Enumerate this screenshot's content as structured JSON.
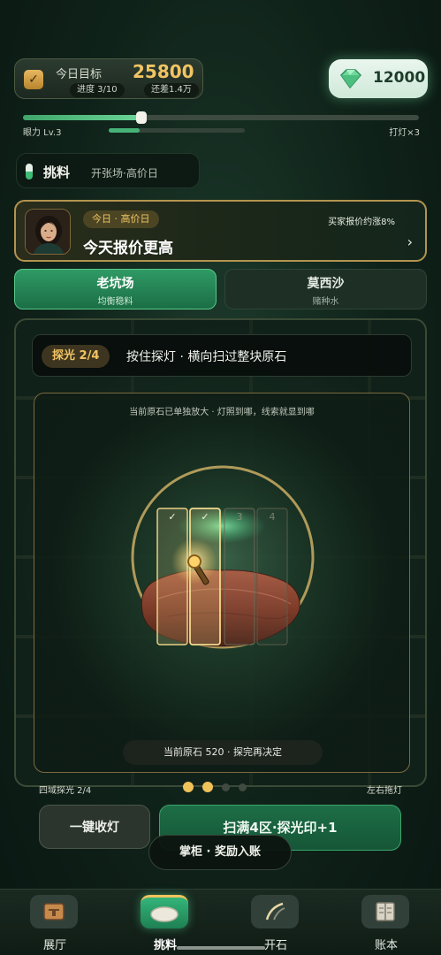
{
  "hud": {
    "goal_title": "今日目标",
    "goal_value": "25800",
    "progress": "进度 3/10",
    "remaining": "还差1.4万",
    "gems": "12000",
    "eye_label": "眼力 Lv.3",
    "eye_progress": 0.3,
    "lamp_label": "打灯×3",
    "lamp_progress": 0.23
  },
  "mode": {
    "title": "挑料",
    "subtitle": "开张场·高价日"
  },
  "buyer": {
    "badge": "今日 · 高价日",
    "headline": "今天报价更高",
    "note": "买家报价约涨8%",
    "arrow": "›"
  },
  "tabs": [
    {
      "name": "老坑场",
      "desc": "均衡稳料",
      "active": true
    },
    {
      "name": "莫西沙",
      "desc": "赌种水",
      "active": false
    }
  ],
  "play": {
    "probe_badge": "探光 2/4",
    "hint": "按住探灯 · 横向扫过整块原石",
    "stage_caption": "当前原石已单独放大 · 灯照到哪，线索就显到哪",
    "zones": [
      {
        "label": "✓",
        "done": true
      },
      {
        "label": "✓",
        "done": true
      },
      {
        "label": "3",
        "done": false
      },
      {
        "label": "4",
        "done": false
      }
    ],
    "stone_count": "当前原石 520 · 探完再决定",
    "region_label": "四域探光 2/4",
    "drag_label": "左右拖灯",
    "page_dots": [
      true,
      true,
      false,
      false
    ]
  },
  "actions": {
    "collect": "一键收灯",
    "scan": "扫满4区·探光印+1",
    "toast": "掌柜 · 奖励入账"
  },
  "nav": [
    {
      "label": "展厅",
      "icon": "hall-icon",
      "active": false
    },
    {
      "label": "挑料",
      "icon": "stone-icon",
      "active": true
    },
    {
      "label": "开石",
      "icon": "saw-icon",
      "active": false
    },
    {
      "label": "账本",
      "icon": "ledger-icon",
      "active": false
    }
  ],
  "colors": {
    "accent_gold": "#f1c463",
    "accent_green": "#2f9a64",
    "background": "#0f2219"
  }
}
